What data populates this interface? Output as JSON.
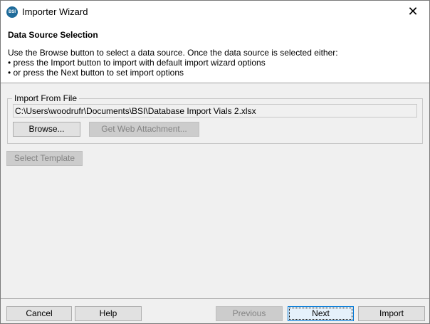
{
  "window": {
    "title": "Importer Wizard",
    "logo_text": "BSI"
  },
  "header": {
    "title": "Data Source Selection",
    "lines": [
      "Use the Browse button to select a data source. Once the data source is selected either:",
      "• press the Import button to import with default import wizard options",
      "• or press the Next button to set import options"
    ]
  },
  "import_from_file": {
    "label": "Import From File",
    "path": "C:\\Users\\woodrufr\\Documents\\BSI\\Database Import Vials 2.xlsx",
    "browse": "Browse...",
    "web_attachment": "Get Web Attachment..."
  },
  "select_template": "Select Template",
  "footer": {
    "cancel": "Cancel",
    "help": "Help",
    "previous": "Previous",
    "next": "Next",
    "import": "Import"
  }
}
